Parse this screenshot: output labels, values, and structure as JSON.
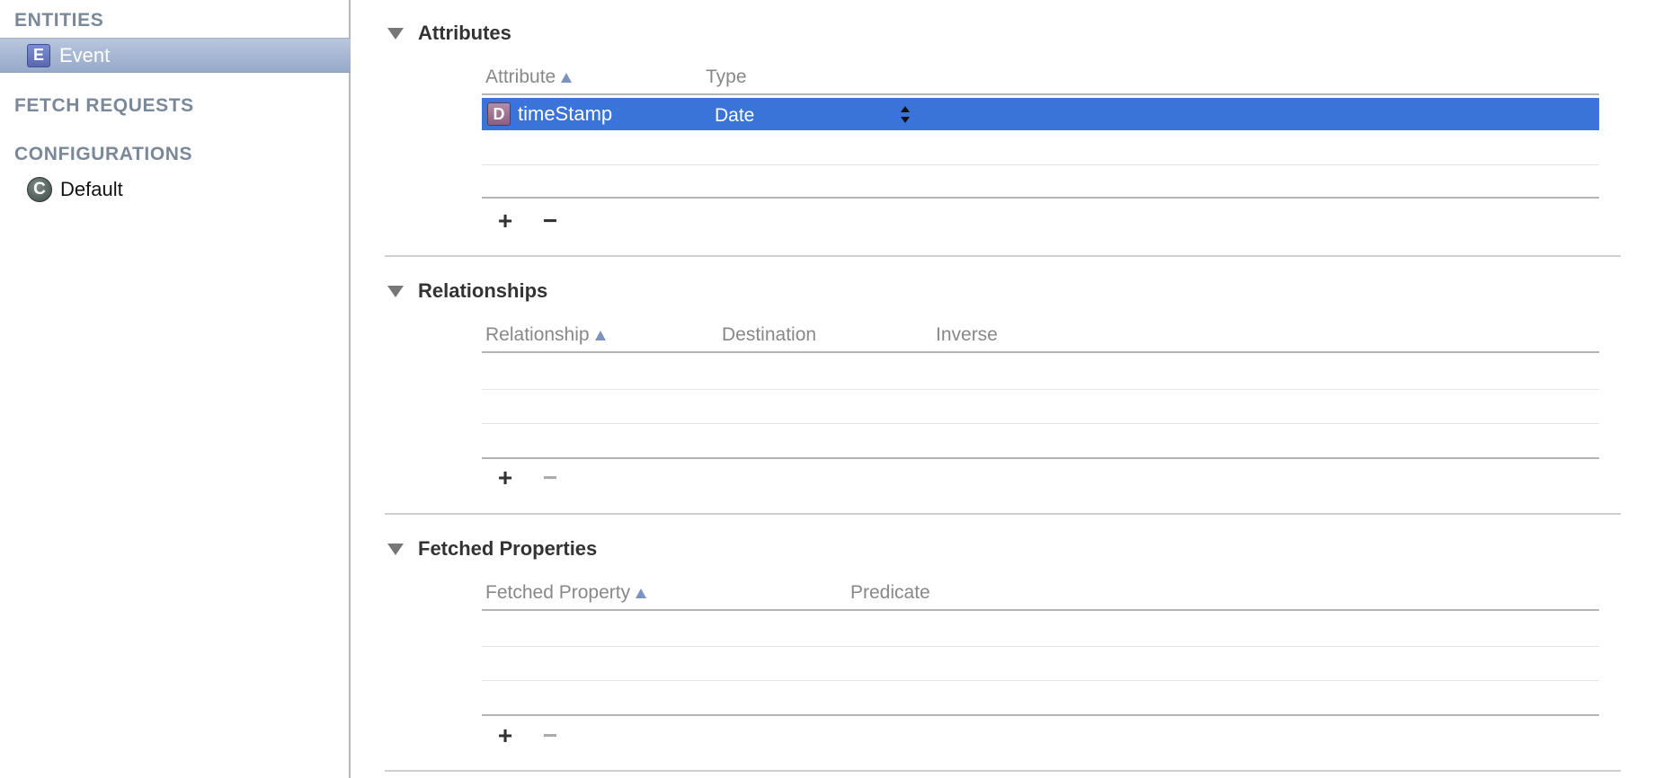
{
  "sidebar": {
    "entities_header": "ENTITIES",
    "entities": [
      {
        "badge": "E",
        "label": "Event",
        "selected": true
      }
    ],
    "fetch_header": "FETCH REQUESTS",
    "config_header": "CONFIGURATIONS",
    "configurations": [
      {
        "badge": "C",
        "label": "Default"
      }
    ]
  },
  "attributes": {
    "title": "Attributes",
    "columns": [
      "Attribute",
      "Type"
    ],
    "rows": [
      {
        "badge": "D",
        "name": "timeStamp",
        "type": "Date",
        "selected": true
      }
    ],
    "add_label": "+",
    "remove_label": "−"
  },
  "relationships": {
    "title": "Relationships",
    "columns": [
      "Relationship",
      "Destination",
      "Inverse"
    ],
    "add_label": "+",
    "remove_label": "−"
  },
  "fetched_properties": {
    "title": "Fetched Properties",
    "columns": [
      "Fetched Property",
      "Predicate"
    ],
    "add_label": "+",
    "remove_label": "−"
  },
  "colors": {
    "selection_blue": "#3a74d8",
    "sidebar_selection": "#a7b7d4",
    "header_gray": "#7a8899"
  }
}
